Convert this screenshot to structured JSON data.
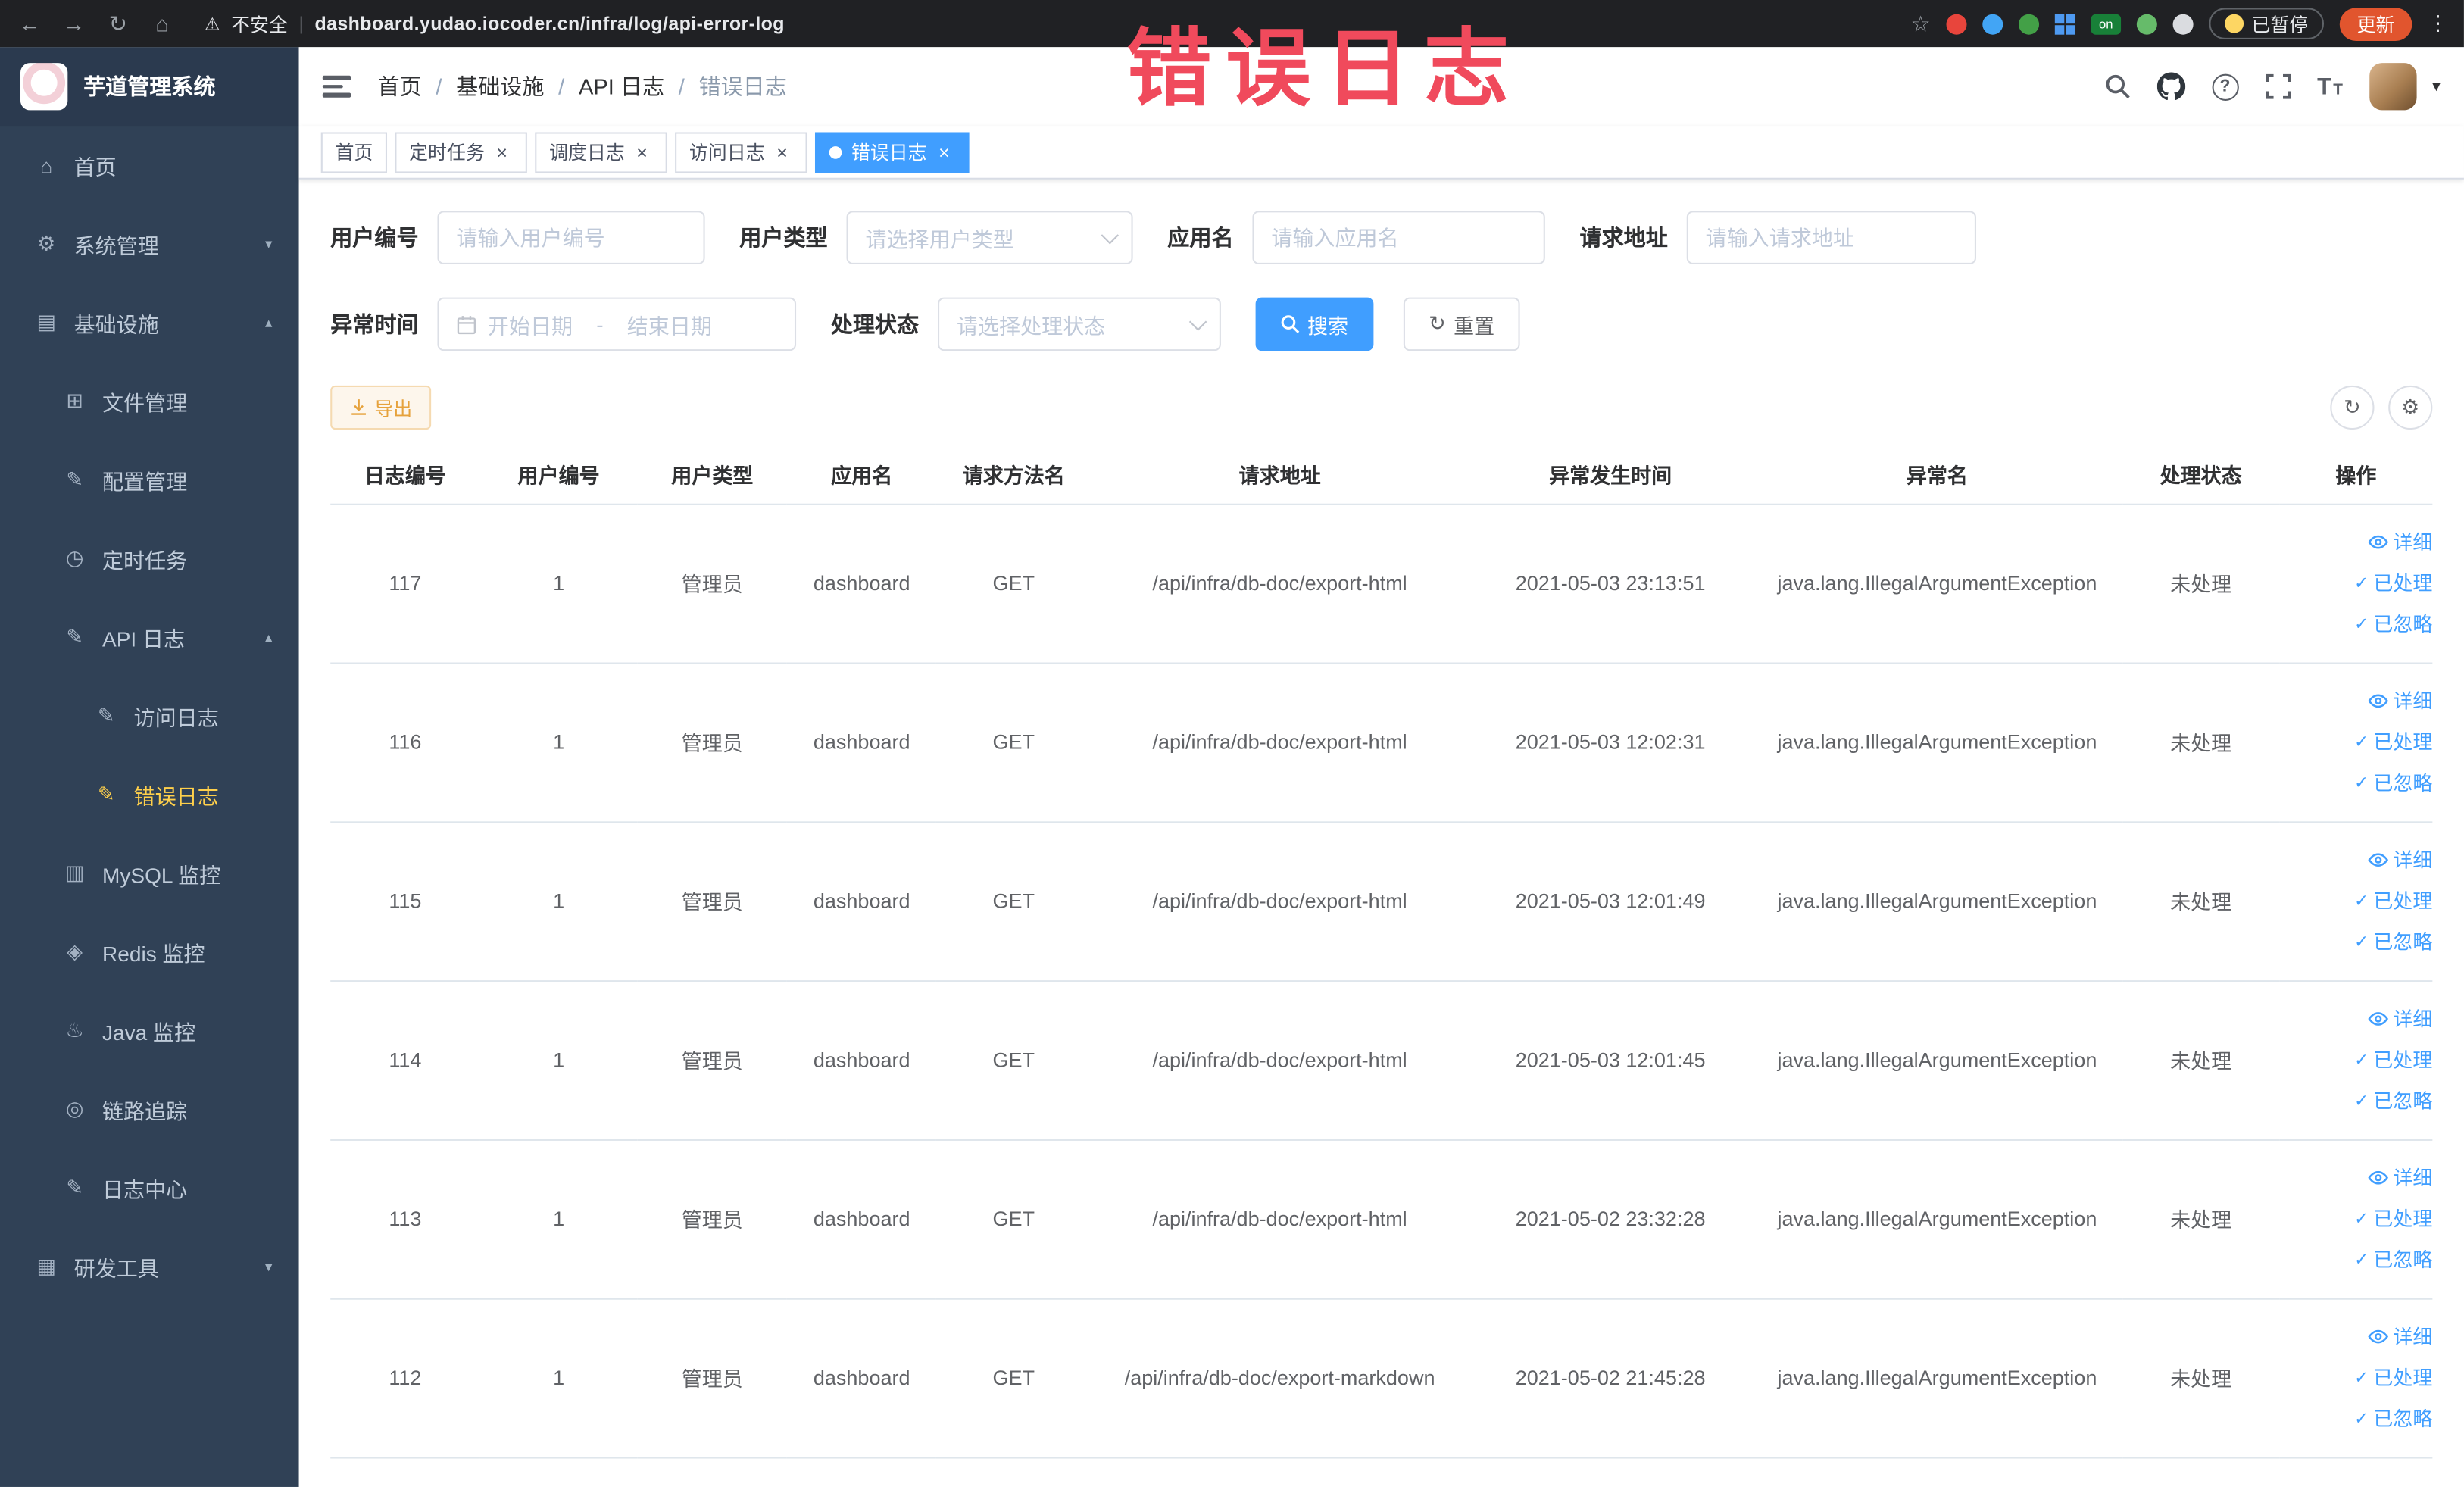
{
  "browser": {
    "security_label": "不安全",
    "url": "dashboard.yudao.iocoder.cn/infra/log/api-error-log",
    "paused_label": "已暂停",
    "update_label": "更新",
    "extension_on_label": "on"
  },
  "annotation": {
    "text": "错误日志",
    "color": "#f04a5c"
  },
  "icons": {
    "back": "←",
    "forward": "→",
    "reload": "↻",
    "home": "⌂",
    "warning": "⚠",
    "star": "☆",
    "kebab": "⋮",
    "close": "×",
    "check": "✓",
    "arrow_down": "▾",
    "arrow_up": "▴",
    "caret_down": "▾",
    "refresh": "↻",
    "gear": "⚙",
    "font_size": "T"
  },
  "sidebar": {
    "logo_title": "芋道管理系统",
    "items": [
      {
        "label": "首页",
        "icon": "⌂"
      },
      {
        "label": "系统管理",
        "icon": "⚙"
      },
      {
        "label": "基础设施",
        "icon": "▤"
      },
      {
        "label": "文件管理",
        "icon": "⊞"
      },
      {
        "label": "配置管理",
        "icon": "✎"
      },
      {
        "label": "定时任务",
        "icon": "◷"
      },
      {
        "label": "API 日志",
        "icon": "✎"
      },
      {
        "label": "访问日志",
        "icon": "✎"
      },
      {
        "label": "错误日志",
        "icon": "✎"
      },
      {
        "label": "MySQL 监控",
        "icon": "▥"
      },
      {
        "label": "Redis 监控",
        "icon": "◈"
      },
      {
        "label": "Java 监控",
        "icon": "♨"
      },
      {
        "label": "链路追踪",
        "icon": "◎"
      },
      {
        "label": "日志中心",
        "icon": "✎"
      },
      {
        "label": "研发工具",
        "icon": "▦"
      }
    ]
  },
  "breadcrumb": {
    "items": [
      "首页",
      "基础设施",
      "API 日志",
      "错误日志"
    ],
    "separator": "/"
  },
  "tabs": [
    {
      "label": "首页"
    },
    {
      "label": "定时任务"
    },
    {
      "label": "调度日志"
    },
    {
      "label": "访问日志"
    },
    {
      "label": "错误日志"
    }
  ],
  "filters": {
    "user_id_label": "用户编号",
    "user_id_placeholder": "请输入用户编号",
    "user_type_label": "用户类型",
    "user_type_placeholder": "请选择用户类型",
    "app_name_label": "应用名",
    "app_name_placeholder": "请输入应用名",
    "request_url_label": "请求地址",
    "request_url_placeholder": "请输入请求地址",
    "time_label": "异常时间",
    "time_start_placeholder": "开始日期",
    "time_separator": "-",
    "time_end_placeholder": "结束日期",
    "status_label": "处理状态",
    "status_placeholder": "请选择处理状态",
    "search_label": "搜索",
    "reset_label": "重置"
  },
  "toolbar": {
    "export_label": "导出"
  },
  "table": {
    "columns": [
      "日志编号",
      "用户编号",
      "用户类型",
      "应用名",
      "请求方法名",
      "请求地址",
      "异常发生时间",
      "异常名",
      "处理状态",
      "操作"
    ],
    "actions": {
      "detail": "详细",
      "process": "已处理",
      "ignore": "已忽略"
    },
    "rows": [
      {
        "id": "117",
        "user_id": "1",
        "user_type": "管理员",
        "app": "dashboard",
        "method": "GET",
        "url": "/api/infra/db-doc/export-html",
        "time": "2021-05-03 23:13:51",
        "exception": "java.lang.IllegalArgumentException",
        "status": "未处理"
      },
      {
        "id": "116",
        "user_id": "1",
        "user_type": "管理员",
        "app": "dashboard",
        "method": "GET",
        "url": "/api/infra/db-doc/export-html",
        "time": "2021-05-03 12:02:31",
        "exception": "java.lang.IllegalArgumentException",
        "status": "未处理"
      },
      {
        "id": "115",
        "user_id": "1",
        "user_type": "管理员",
        "app": "dashboard",
        "method": "GET",
        "url": "/api/infra/db-doc/export-html",
        "time": "2021-05-03 12:01:49",
        "exception": "java.lang.IllegalArgumentException",
        "status": "未处理"
      },
      {
        "id": "114",
        "user_id": "1",
        "user_type": "管理员",
        "app": "dashboard",
        "method": "GET",
        "url": "/api/infra/db-doc/export-html",
        "time": "2021-05-03 12:01:45",
        "exception": "java.lang.IllegalArgumentException",
        "status": "未处理"
      },
      {
        "id": "113",
        "user_id": "1",
        "user_type": "管理员",
        "app": "dashboard",
        "method": "GET",
        "url": "/api/infra/db-doc/export-html",
        "time": "2021-05-02 23:32:28",
        "exception": "java.lang.IllegalArgumentException",
        "status": "未处理"
      },
      {
        "id": "112",
        "user_id": "1",
        "user_type": "管理员",
        "app": "dashboard",
        "method": "GET",
        "url": "/api/infra/db-doc/export-markdown",
        "time": "2021-05-02 21:45:28",
        "exception": "java.lang.IllegalArgumentException",
        "status": "未处理"
      }
    ]
  }
}
